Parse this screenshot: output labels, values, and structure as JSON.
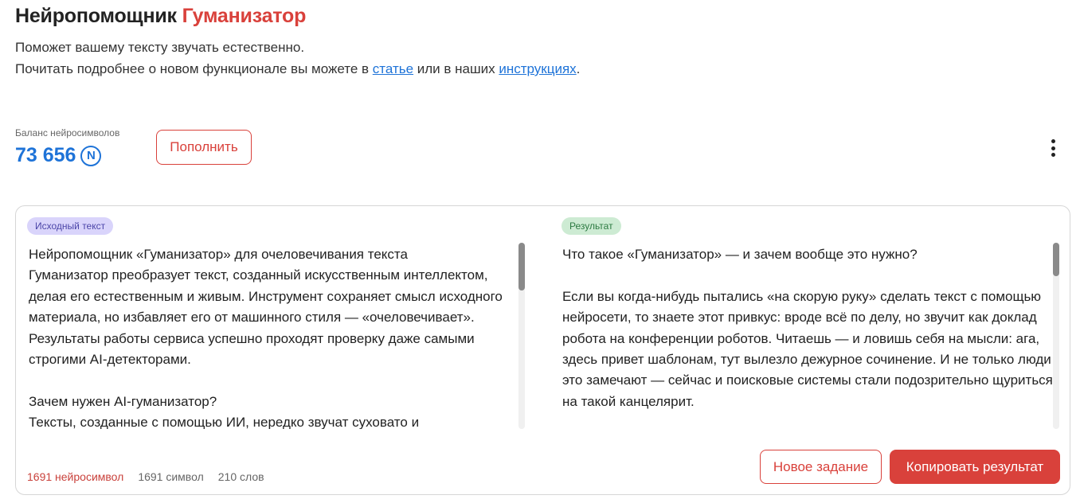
{
  "header": {
    "title_prefix": "Нейропомощник ",
    "title_accent": "Гуманизатор",
    "subtitle_line1": "Поможет вашему тексту звучать естественно.",
    "subtitle_line2_before": "Почитать подробнее о новом функционале вы можете в ",
    "link_article": "статье",
    "subtitle_line2_middle": " или в наших ",
    "link_instructions": "инструкциях",
    "subtitle_line2_after": "."
  },
  "balance": {
    "label": "Баланс нейросимволов",
    "value": "73 656",
    "currency_symbol": "N",
    "topup_label": "Пополнить"
  },
  "editor": {
    "source_badge": "Исходный текст",
    "result_badge": "Результат",
    "source_text": "Нейропомощник «Гуманизатор» для очеловечивания текста\nГуманизатор преобразует текст, созданный искусственным интеллектом, делая его естественным и живым. Инструмент сохраняет смысл исходного материала, но избавляет его от машинного стиля — «очеловечивает». Результаты работы сервиса успешно проходят проверку даже самыми строгими AI-детекторами.\n\nЗачем нужен AI-гуманизатор?\nТексты, созданные с помощью ИИ, нередко звучат суховато и",
    "result_text": "Что такое «Гуманизатор» — и зачем вообще это нужно?\n\nЕсли вы когда-нибудь пытались «на скорую руку» сделать текст с помощью нейросети, то знаете этот привкус: вроде всё по делу, но звучит как доклад робота на конференции роботов. Читаешь — и ловишь себя на мысли: ага, здесь привет шаблонам, тут вылезло дежурное сочинение. И не только люди это замечают — сейчас и поисковые системы стали подозрительно щуриться на такой канцелярит.",
    "stats": {
      "neuro_symbols": "1691 нейросимвол",
      "symbols": "1691 символ",
      "words": "210 слов"
    },
    "new_task_label": "Новое задание",
    "copy_label": "Копировать результат"
  },
  "colors": {
    "accent": "#d9413b",
    "link": "#1e73d8",
    "source_badge_bg": "#d9d4fb",
    "result_badge_bg": "#cdebd3"
  },
  "icons": {
    "currency": "neurosymbol-coin-icon",
    "menu": "more-vertical-icon"
  }
}
